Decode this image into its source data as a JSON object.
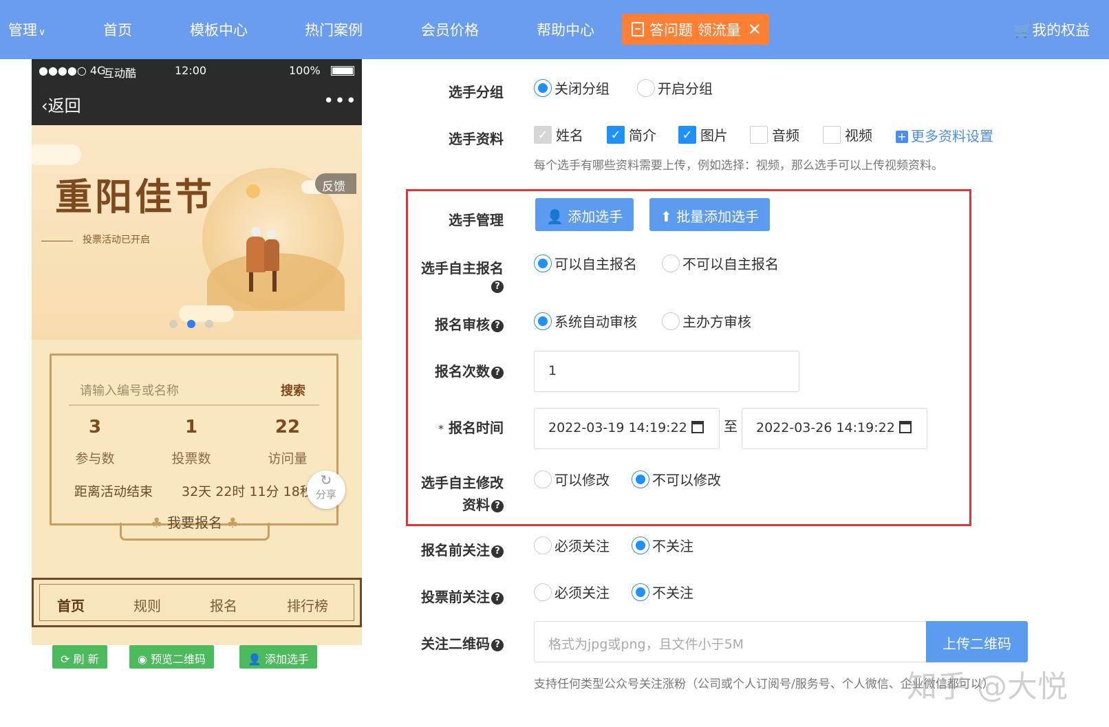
{
  "nav": {
    "manage": "管理",
    "items": [
      "首页",
      "模板中心",
      "热门案例",
      "会员价格",
      "帮助中心"
    ],
    "promo": "答问题 领流量",
    "rights": "我的权益"
  },
  "phone": {
    "status": {
      "signal": "●●●●○ 4G",
      "carrier": "互动酷",
      "time": "12:00",
      "battery": "100%"
    },
    "back": "返回",
    "more": "•••",
    "banner_title": "重阳佳节",
    "banner_sub": "投票活动已开启",
    "feedback": "反馈",
    "search_placeholder": "请输入编号或名称",
    "search_btn": "搜索",
    "stats": [
      {
        "num": "3",
        "label": "参与数"
      },
      {
        "num": "1",
        "label": "投票数"
      },
      {
        "num": "22",
        "label": "访问量"
      }
    ],
    "countdown_label": "距离活动结束",
    "countdown_value": "32天 22时 11分 18秒",
    "share": "分享",
    "signup": "我要报名",
    "tabs": [
      "首页",
      "规则",
      "报名",
      "排行榜"
    ],
    "buttons": {
      "refresh": "刷 新",
      "preview": "预览二维码",
      "add": "添加选手"
    }
  },
  "form": {
    "group": {
      "label": "选手分组",
      "options": [
        "关闭分组",
        "开启分组"
      ],
      "selected": 0
    },
    "info": {
      "label": "选手资料",
      "checks": [
        {
          "text": "姓名",
          "state": "disabled"
        },
        {
          "text": "简介",
          "state": "checked"
        },
        {
          "text": "图片",
          "state": "checked"
        },
        {
          "text": "音频",
          "state": "unchecked"
        },
        {
          "text": "视频",
          "state": "unchecked"
        }
      ],
      "more": "更多资料设置",
      "hint": "每个选手有哪些资料需要上传，例如选择：视频，那么选手可以上传视频资料。"
    },
    "manage": {
      "label": "选手管理",
      "add": "添加选手",
      "batch": "批量添加选手"
    },
    "self_signup": {
      "label": "选手自主报名",
      "options": [
        "可以自主报名",
        "不可以自主报名"
      ],
      "selected": 0
    },
    "review": {
      "label": "报名审核",
      "options": [
        "系统自动审核",
        "主办方审核"
      ],
      "selected": 0
    },
    "times": {
      "label": "报名次数",
      "value": "1"
    },
    "period": {
      "label": "报名时间",
      "star": "*",
      "start": "2022-03-19 14:19:22",
      "to": "至",
      "end": "2022-03-26 14:19:22"
    },
    "self_edit": {
      "label_line1": "选手自主修改",
      "label_line2": "资料",
      "options": [
        "可以修改",
        "不可以修改"
      ],
      "selected": 1
    },
    "follow_before_signup": {
      "label": "报名前关注",
      "options": [
        "必须关注",
        "不关注"
      ],
      "selected": 1
    },
    "follow_before_vote": {
      "label": "投票前关注",
      "options": [
        "必须关注",
        "不关注"
      ],
      "selected": 1
    },
    "qrcode": {
      "label": "关注二维码",
      "placeholder": "格式为jpg或png，且文件小于5M",
      "upload": "上传二维码",
      "hint": "支持任何类型公众号关注涨粉（公司或个人订阅号/服务号、个人微信、企业微信都可以）"
    },
    "watermark": "知乎 @大悦"
  },
  "colors": {
    "nav_bg": "#6a9cf0",
    "promo": "#ff7f33",
    "blue_btn": "#5b9bf0",
    "radio": "#1e90ff",
    "highlight": "#e0323a",
    "green_btn": "#4cbb5e"
  }
}
